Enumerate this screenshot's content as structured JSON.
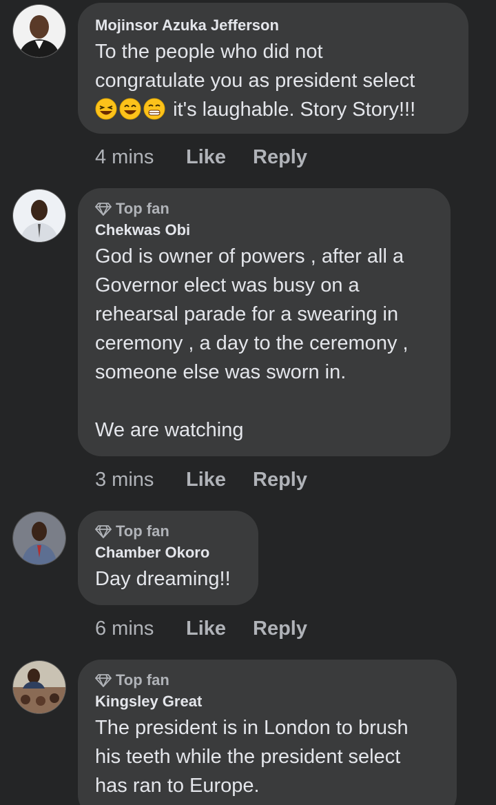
{
  "comments": [
    {
      "author": "Mojinsor Azuka Jefferson",
      "top_fan": false,
      "text": "To the people who did not\ncongratulate you as president select",
      "text_tail": "it's laughable. Story Story!!!",
      "time": "4 mins",
      "like_label": "Like",
      "reply_label": "Reply"
    },
    {
      "author": "Chekwas Obi",
      "top_fan": true,
      "badge": "Top fan",
      "text": "God is owner of powers , after all a\nGovernor elect was busy on a\nrehearsal parade for a swearing in\nceremony , a day to the ceremony ,\nsomeone else was sworn in.\n\nWe are watching",
      "time": "3 mins",
      "like_label": "Like",
      "reply_label": "Reply"
    },
    {
      "author": "Chamber Okoro",
      "top_fan": true,
      "badge": "Top fan",
      "text": "Day dreaming!!",
      "time": "6 mins",
      "like_label": "Like",
      "reply_label": "Reply"
    },
    {
      "author": "Kingsley Great",
      "top_fan": true,
      "badge": "Top fan",
      "text": "The president is in London to brush\nhis teeth while the president select\nhas ran to Europe.",
      "time": "",
      "like_label": "",
      "reply_label": ""
    }
  ],
  "colors": {
    "background": "#242526",
    "bubble": "#3a3b3c",
    "primary_text": "#e4e6eb",
    "secondary_text": "#b0b3b8"
  }
}
